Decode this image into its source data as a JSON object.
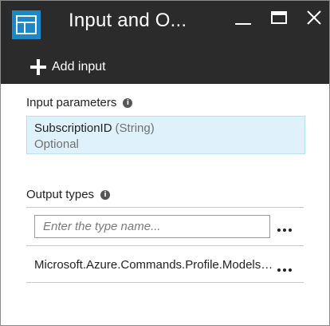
{
  "header": {
    "title": "Input and O...",
    "icon": "blade-layout-icon",
    "controls": [
      "minimize-icon",
      "maximize-icon",
      "close-icon"
    ]
  },
  "toolbar": {
    "add_input_label": "Add input",
    "add_input_icon": "plus-icon"
  },
  "input_parameters": {
    "label": "Input parameters",
    "items": [
      {
        "name": "SubscriptionID",
        "type": "(String)",
        "status": "Optional"
      }
    ]
  },
  "output_types": {
    "label": "Output types",
    "input_placeholder": "Enter the type name...",
    "input_value": "",
    "items": [
      {
        "name": "Microsoft.Azure.Commands.Profile.Models.PSAzureContext"
      }
    ]
  },
  "colors": {
    "header_bg": "#2b2b2b",
    "accent_blue": "#1e88c7",
    "selected_row_bg": "#dff2fb"
  }
}
